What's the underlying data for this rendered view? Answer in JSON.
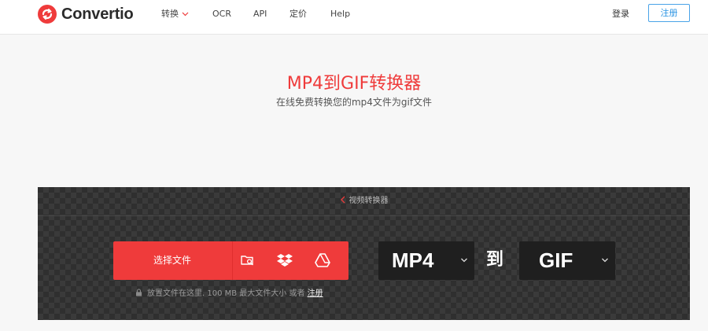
{
  "brand": {
    "name": "Convertio",
    "color": "#ef3b3b"
  },
  "nav": {
    "items": [
      {
        "label": "转换",
        "has_dropdown": true
      },
      {
        "label": "OCR"
      },
      {
        "label": "API"
      },
      {
        "label": "定价"
      },
      {
        "label": "Help"
      }
    ],
    "login_label": "登录",
    "signup_label": "注册"
  },
  "hero": {
    "title": "MP4到GIF转换器",
    "subtitle": "在线免费转换您的mp4文件为gif文件"
  },
  "converter": {
    "breadcrumb": "视频转换器",
    "upload": {
      "label": "选择文件",
      "sources": [
        {
          "icon": "folder-search-icon"
        },
        {
          "icon": "dropbox-icon"
        },
        {
          "icon": "google-drive-icon"
        }
      ]
    },
    "drop_hint": {
      "text": "放置文件在这里. 100 MB 最大文件大小 或者",
      "link": "注册"
    },
    "from_format": "MP4",
    "to_label": "到",
    "to_format": "GIF"
  }
}
